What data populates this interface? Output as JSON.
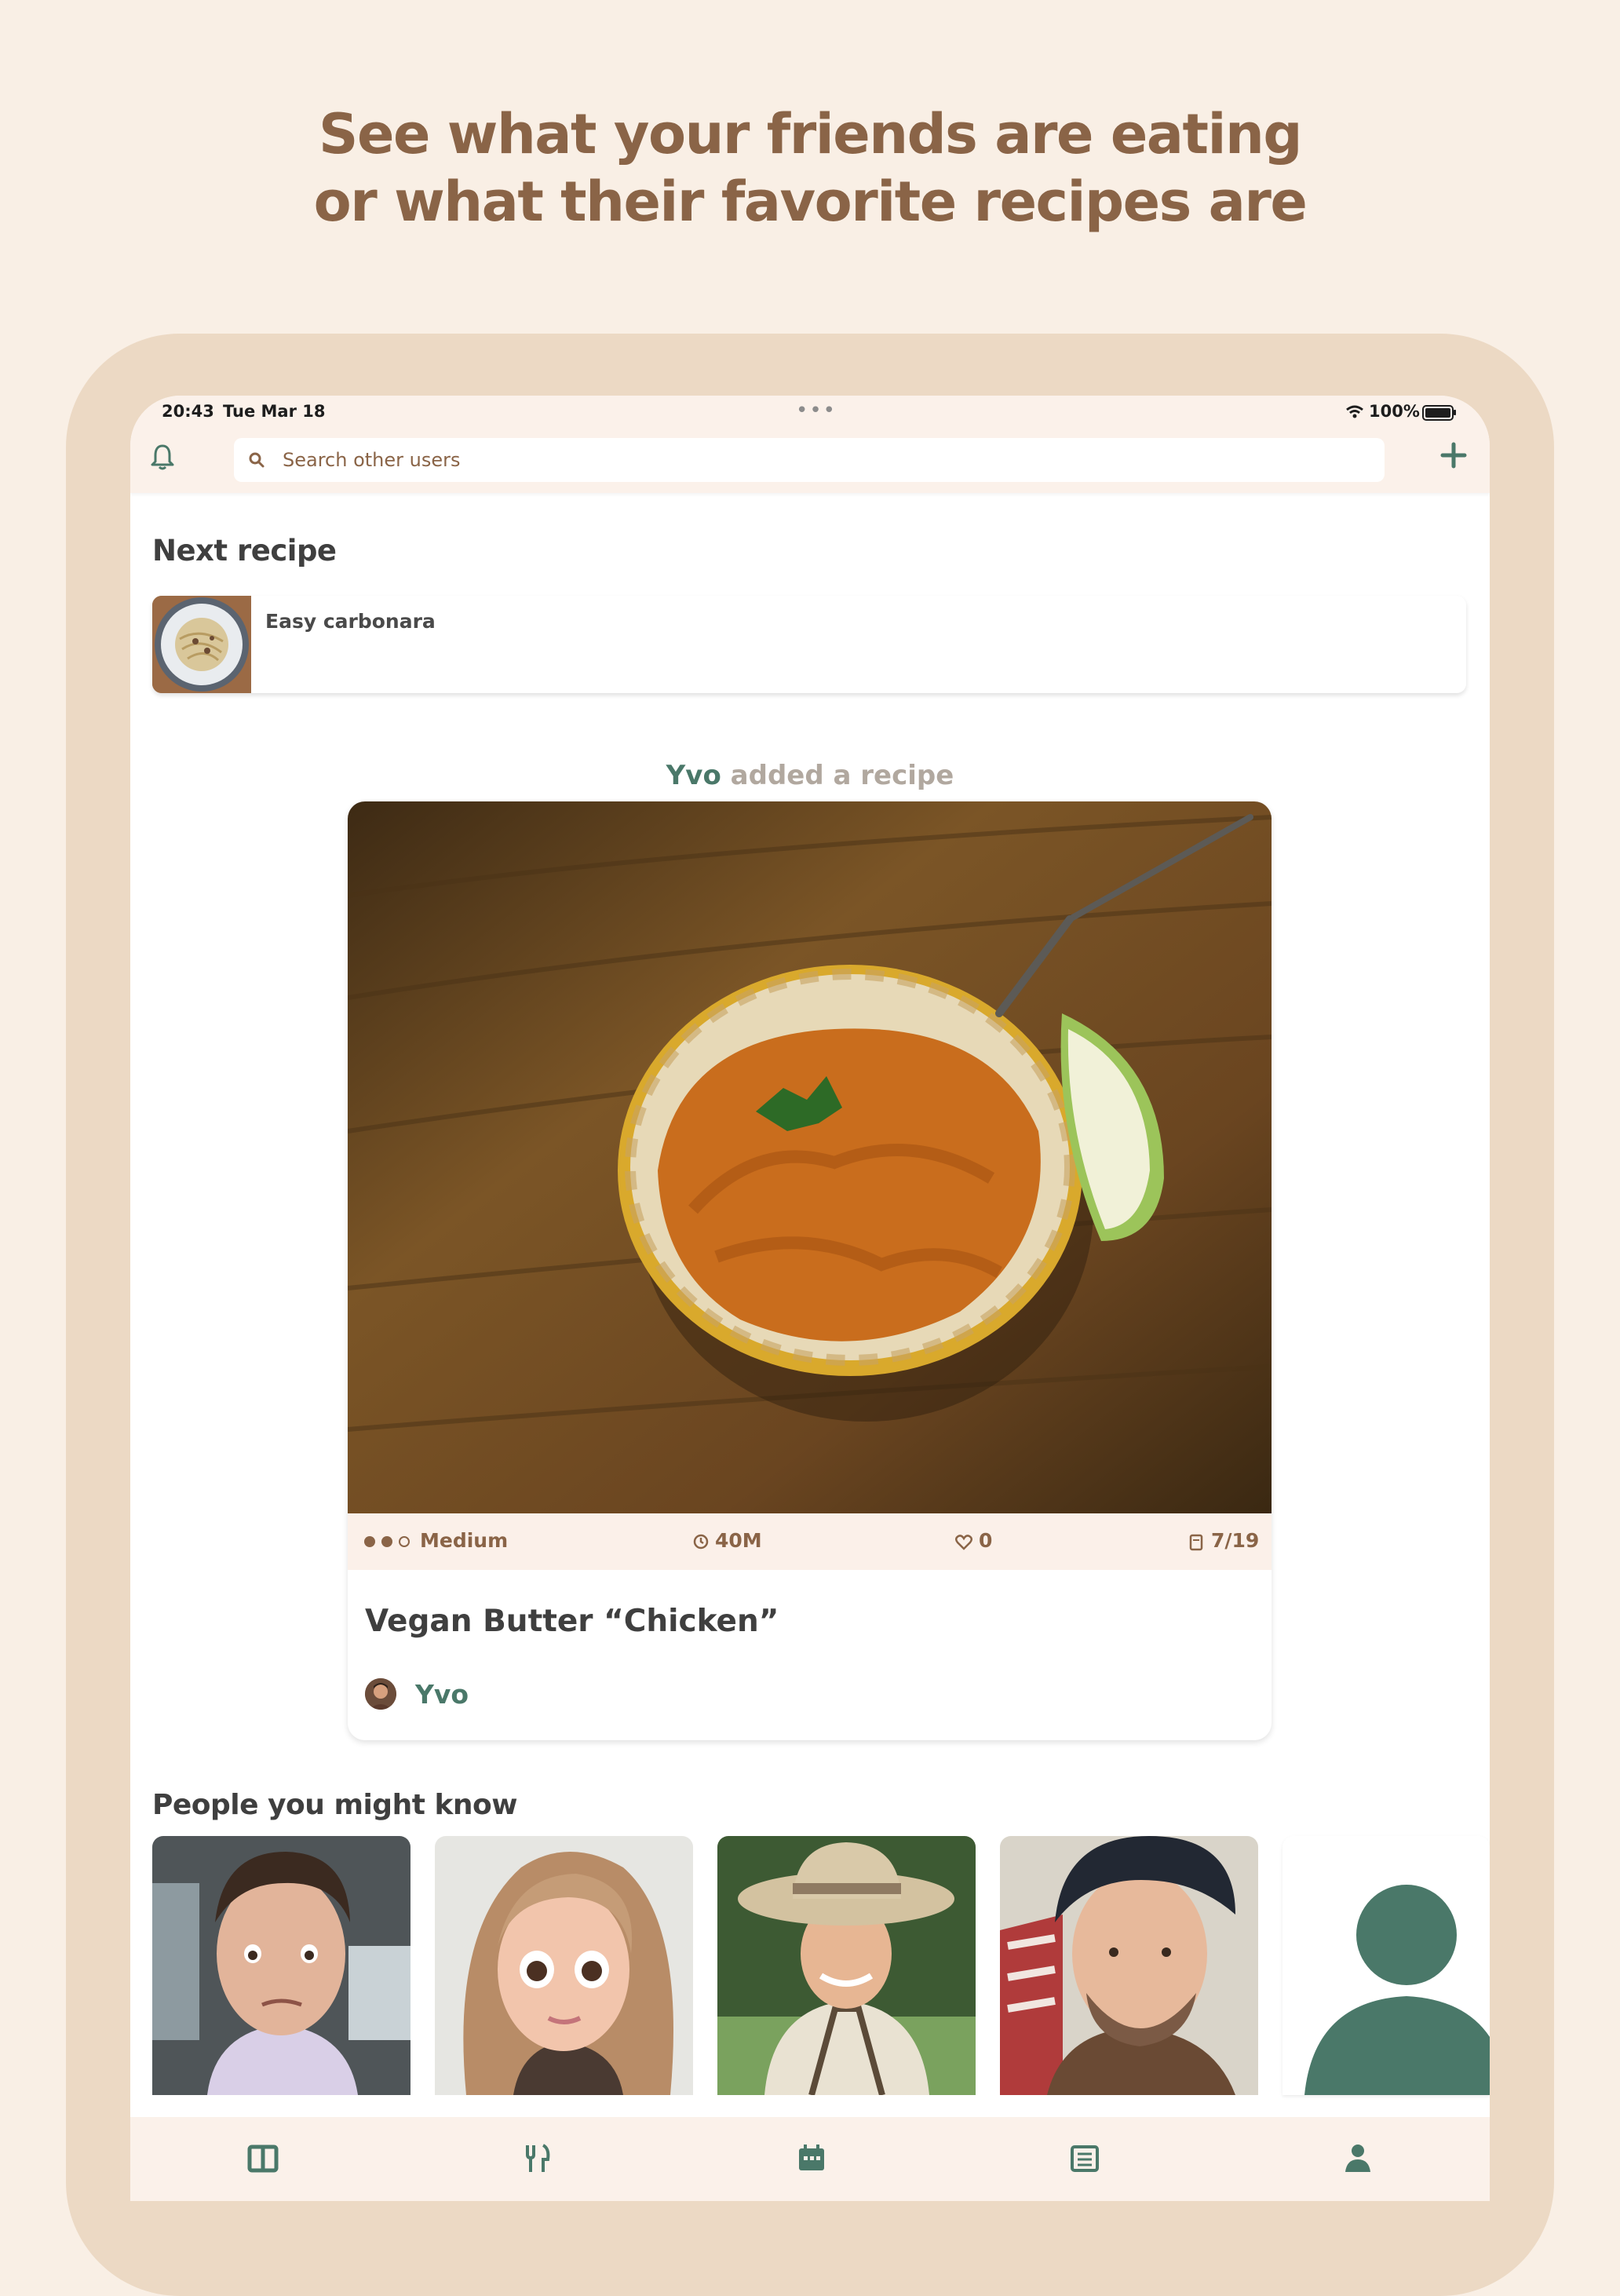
{
  "headline": {
    "line1": "See what your friends are eating",
    "line2": "or what their favorite recipes are"
  },
  "status_bar": {
    "time": "20:43",
    "date": "Tue Mar 18",
    "battery": "100%"
  },
  "header": {
    "search_placeholder": "Search other users"
  },
  "next_recipe": {
    "section_title": "Next recipe",
    "recipe_title": "Easy carbonara"
  },
  "activity": {
    "user": "Yvo",
    "action": "added a recipe"
  },
  "post": {
    "difficulty": "Medium",
    "difficulty_level": 2,
    "difficulty_max": 3,
    "time": "40M",
    "likes": "0",
    "date": "7/19",
    "title": "Vegan Butter “Chicken”",
    "author": "Yvo"
  },
  "people": {
    "section_title": "People you might know"
  },
  "colors": {
    "accent": "#4a7869",
    "brown": "#8a6447",
    "background": "#f9efe5",
    "frame": "#ecd9c4"
  },
  "tabs": [
    {
      "icon": "book-icon"
    },
    {
      "icon": "fork-knife-icon"
    },
    {
      "icon": "calendar-icon"
    },
    {
      "icon": "list-icon"
    },
    {
      "icon": "profile-icon"
    }
  ]
}
